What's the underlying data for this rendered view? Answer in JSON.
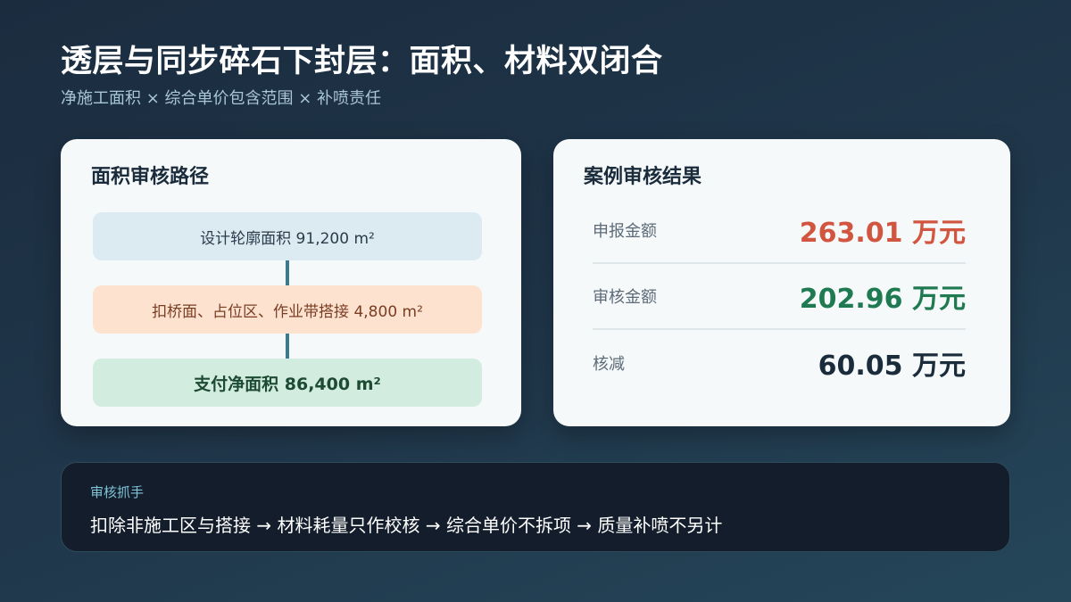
{
  "header": {
    "title": "透层与同步碎石下封层：面积、材料双闭合",
    "subtitle": "净施工面积 × 综合单价包含范围 × 补喷责任"
  },
  "area_card": {
    "title": "面积审核路径",
    "steps": [
      "设计轮廓面积 91,200 m²",
      "扣桥面、占位区、作业带搭接 4,800 m²",
      "支付净面积 86,400 m²"
    ]
  },
  "result_card": {
    "title": "案例审核结果",
    "rows": [
      {
        "label": "申报金额",
        "value": "263.01 万元",
        "color": "#d2553f"
      },
      {
        "label": "审核金额",
        "value": "202.96 万元",
        "color": "#1f7a52"
      },
      {
        "label": "核减",
        "value": "60.05 万元",
        "color": "#1a2b3b"
      }
    ]
  },
  "note": {
    "label": "审核抓手",
    "text": "扣除非施工区与搭接 → 材料耗量只作校核 → 综合单价不拆项 → 质量补喷不另计"
  }
}
